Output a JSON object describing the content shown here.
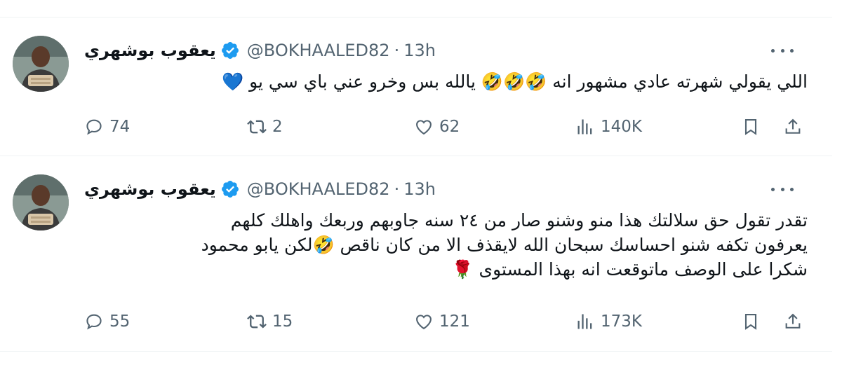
{
  "tweets": [
    {
      "author_name": "يعقوب بوشهري",
      "handle": "@BOKHAALED82",
      "separator": "·",
      "time": "13h",
      "text": "اللي يقولي شهرته عادي مشهور انه 🤣🤣🤣 يالله بس وخرو عني باي سي يو 💙",
      "replies": "74",
      "retweets": "2",
      "likes": "62",
      "views": "140K"
    },
    {
      "author_name": "يعقوب بوشهري",
      "handle": "@BOKHAALED82",
      "separator": "·",
      "time": "13h",
      "text": "تقدر تقول حق سلالتك هذا منو وشنو صار من ٢٤ سنه جاوبهم وربعك واهلك كلهم\nيعرفون تكفه شنو احساسك سبحان الله لايقذف الا من كان ناقص 🤣لكن يابو محمود\nشكرا على الوصف ماتوقعت انه بهذا المستوى 🌹",
      "replies": "55",
      "retweets": "15",
      "likes": "121",
      "views": "173K"
    }
  ],
  "colors": {
    "verified_badge": "#1d9bf0",
    "secondary_text": "#536471",
    "primary_text": "#0f1419",
    "divider": "#eff3f4"
  },
  "icons": {
    "reply": "reply-icon",
    "retweet": "retweet-icon",
    "like": "heart-icon",
    "views": "views-icon",
    "bookmark": "bookmark-icon",
    "share": "share-icon",
    "more": "more-icon",
    "verified": "verified-badge-icon"
  }
}
